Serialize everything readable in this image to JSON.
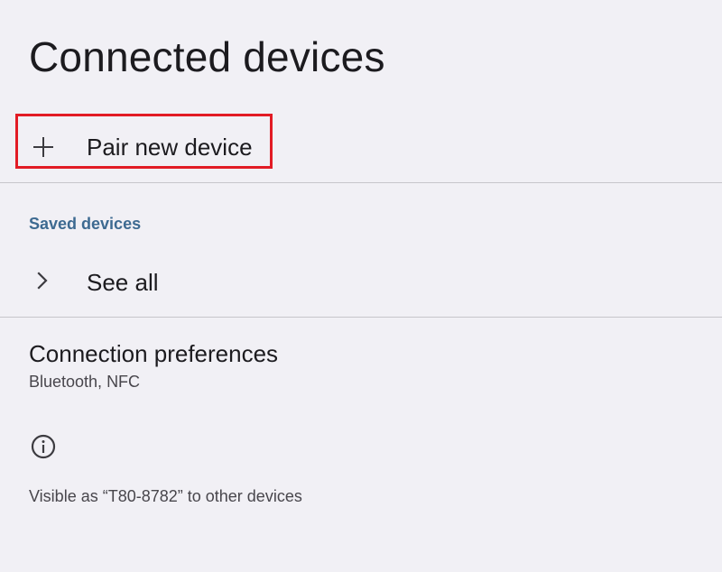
{
  "header": {
    "title": "Connected devices"
  },
  "pair_new_device": {
    "icon": "plus-icon",
    "label": "Pair new device",
    "highlight_color": "#e21b25"
  },
  "saved_devices": {
    "header": "Saved devices",
    "header_color": "#3d6a91",
    "see_all": {
      "icon": "chevron-right-icon",
      "label": "See all"
    }
  },
  "connection_preferences": {
    "title": "Connection preferences",
    "summary": "Bluetooth, NFC"
  },
  "footer": {
    "icon": "info-icon",
    "text": "Visible as “T80-8782” to other devices"
  },
  "colors": {
    "background": "#f1f0f5",
    "text_primary": "#1c1b1f",
    "text_secondary": "#48464c",
    "divider": "#c7c6cb"
  }
}
